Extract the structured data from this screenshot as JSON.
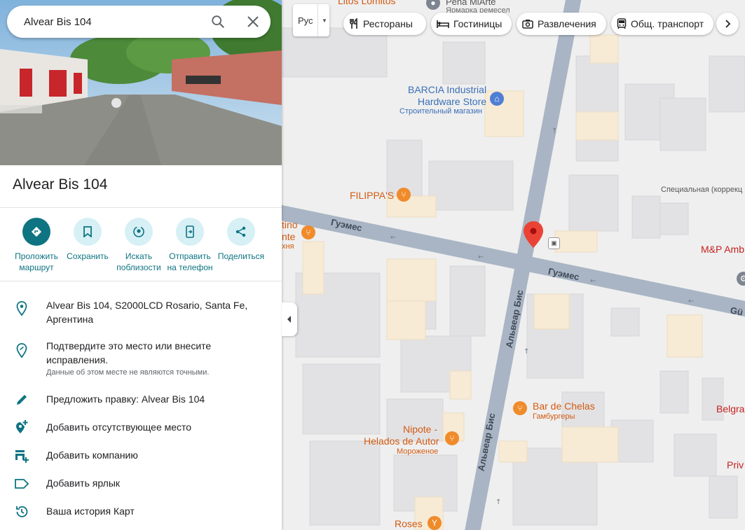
{
  "search": {
    "query": "Alvear Bis 104"
  },
  "place": {
    "title": "Alvear Bis 104"
  },
  "actions": [
    {
      "line1": "Проложить",
      "line2": "маршрут",
      "icon": "directions-icon"
    },
    {
      "line1": "Сохранить",
      "line2": "",
      "icon": "bookmark-icon"
    },
    {
      "line1": "Искать",
      "line2": "поблизости",
      "icon": "nearby-icon"
    },
    {
      "line1": "Отправить",
      "line2": "на телефон",
      "icon": "send-to-phone-icon"
    },
    {
      "line1": "Поделиться",
      "line2": "",
      "icon": "share-icon"
    }
  ],
  "info": {
    "address": "Alvear Bis 104, S2000LCD Rosario, Santa Fe, Аргентина",
    "confirm": "Подтвердите это место или внесите исправления.",
    "confirm_note": "Данные об этом месте не являются точными.",
    "suggest_edit": "Предложить правку: Alvear Bis 104",
    "add_missing": "Добавить отсутствующее место",
    "add_business": "Добавить компанию",
    "add_label": "Добавить ярлык",
    "history": "Ваша история Карт"
  },
  "map": {
    "layer_label": "Рус",
    "chips": [
      "Рестораны",
      "Гостиницы",
      "Развлечения",
      "Общ. транспорт"
    ],
    "streets": {
      "guemes_left": "Гуэмес",
      "guemes_right": "Гуэмес",
      "guemes_edge": "Gü",
      "alvear_upper": "Альвеар Бис",
      "alvear_lower": "Альвеар Бис"
    },
    "pois": {
      "litos": "Litos Lomitos",
      "pena": "Peña MiArte",
      "pena_sub": "Ярмарка ремесел",
      "barcia_1": "BARCIA Industrial",
      "barcia_2": "Hardware Store",
      "barcia_sub": "Строительный магазин",
      "filippas": "FILIPPA'S",
      "tino_1": "tino",
      "tino_2": "nte",
      "tino_sub": "хня",
      "special": "Специальная (коррекц",
      "mp": "M&P Amb",
      "bar_chelas": "Bar de Chelas",
      "bar_chelas_sub": "Гамбургеры",
      "nipote_1": "Nipote -",
      "nipote_2": "Helados de Autor",
      "nipote_sub": "Мороженое",
      "belgra": "Belgra",
      "priv": "Priv",
      "roses": "Roses"
    },
    "colors": {
      "accent": "#0e7482",
      "pin": "#ea4335",
      "poi_orange": "#f08b2b",
      "street": "#aab3c0"
    }
  }
}
